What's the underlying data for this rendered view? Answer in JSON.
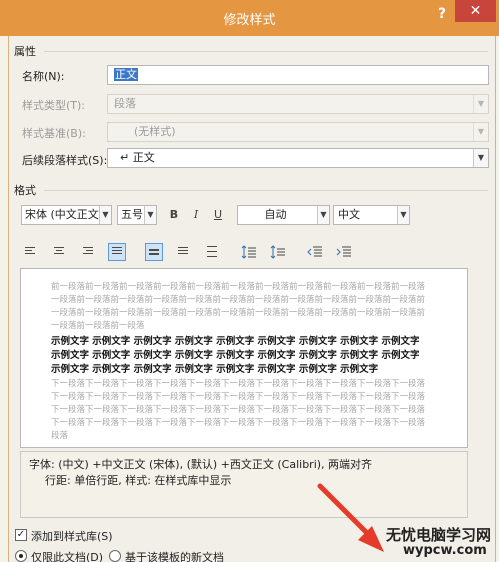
{
  "window": {
    "title": "修改样式",
    "help": "?",
    "close": "✕"
  },
  "properties": {
    "section_title": "属性",
    "name_label": "名称(N):",
    "name_value": "正文",
    "style_type_label": "样式类型(T):",
    "style_type_value": "段落",
    "style_based_label": "样式基准(B):",
    "style_based_value": "(无样式)",
    "next_style_label": "后续段落样式(S):",
    "next_style_value": "↵ 正文"
  },
  "format": {
    "section_title": "格式",
    "font": "宋体 (中文正文)",
    "size": "五号",
    "bold": "B",
    "italic": "I",
    "underline": "U",
    "color": "自动",
    "script": "中文"
  },
  "preview": {
    "faded_before": [
      "前一段落前一段落前一段落前一段落前一段落前一段落前一段落前一段落前一段落前一段落前一段落",
      "一段落前一段落前一段落前一段落前一段落前一段落前一段落前一段落前一段落前一段落前一段落前",
      "一段落前一段落前一段落前一段落前一段落前一段落前一段落前一段落前一段落前一段落前一段落前",
      "一段落前一段落前一段落"
    ],
    "sample": [
      "示例文字 示例文字 示例文字 示例文字 示例文字 示例文字 示例文字 示例文字 示例文字",
      "示例文字 示例文字 示例文字 示例文字 示例文字 示例文字 示例文字 示例文字 示例文字",
      "示例文字 示例文字 示例文字 示例文字 示例文字 示例文字 示例文字 示例文字"
    ],
    "faded_after": [
      "下一段落下一段落下一段落下一段落下一段落下一段落下一段落下一段落下一段落下一段落下一段落",
      "下一段落下一段落下一段落下一段落下一段落下一段落下一段落下一段落下一段落下一段落下一段落",
      "下一段落下一段落下一段落下一段落下一段落下一段落下一段落下一段落下一段落下一段落下一段落",
      "下一段落下一段落下一段落下一段落下一段落下一段落下一段落下一段落下一段落下一段落下一段落",
      "段落"
    ]
  },
  "description": {
    "line1": "字体: (中文) +中文正文 (宋体), (默认) +西文正文 (Calibri), 两端对齐",
    "line2": "行距: 单倍行距, 样式: 在样式库中显示"
  },
  "options": {
    "add_to_gallery_label": "添加到样式库(S)",
    "add_to_gallery_checked": true,
    "only_this_document_label": "仅限此文档(D)",
    "new_template_label": "基于该模板的新文档"
  },
  "watermark": {
    "text": "无忧电脑学习网",
    "url": "wypcw.com"
  },
  "colors": {
    "titlebar": "#e59640",
    "close_button": "#c8453b",
    "selection": "#3d78c8",
    "annotation_arrow": "#e53b2a"
  }
}
